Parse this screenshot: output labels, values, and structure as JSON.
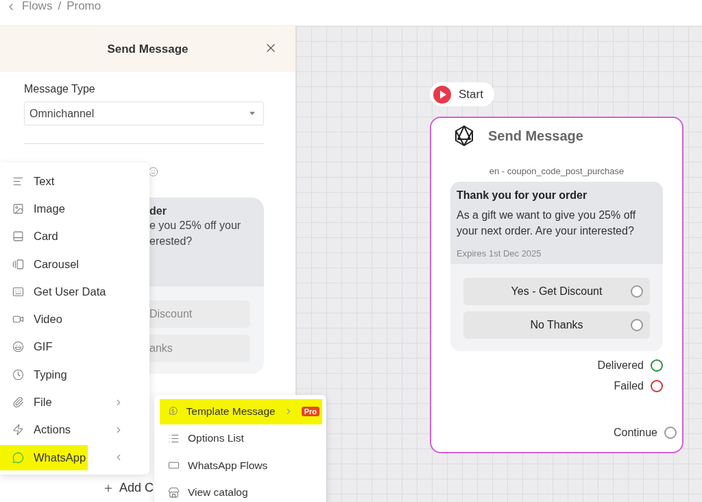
{
  "breadcrumb": {
    "items": [
      "Flows",
      "Promo"
    ],
    "separator": "/"
  },
  "panel": {
    "title": "Send Message",
    "field": {
      "label": "Message Type",
      "value": "Omnichannel"
    },
    "preview": {
      "title": "der",
      "body_lines": [
        "e you 25% off your",
        "erested?"
      ],
      "buttons": [
        "Discount",
        "anks"
      ]
    },
    "add_button": "Add C"
  },
  "menu": {
    "items": [
      {
        "label": "Text",
        "has_submenu": false,
        "highlighted": false
      },
      {
        "label": "Image",
        "has_submenu": false,
        "highlighted": false
      },
      {
        "label": "Card",
        "has_submenu": false,
        "highlighted": false
      },
      {
        "label": "Carousel",
        "has_submenu": false,
        "highlighted": false
      },
      {
        "label": "Get User Data",
        "has_submenu": false,
        "highlighted": false
      },
      {
        "label": "Video",
        "has_submenu": false,
        "highlighted": false
      },
      {
        "label": "GIF",
        "has_submenu": false,
        "highlighted": false
      },
      {
        "label": "Typing",
        "has_submenu": false,
        "highlighted": false
      },
      {
        "label": "File",
        "has_submenu": true,
        "expanded": false,
        "highlighted": false
      },
      {
        "label": "Actions",
        "has_submenu": true,
        "expanded": false,
        "highlighted": false
      },
      {
        "label": "WhatsApp",
        "has_submenu": true,
        "expanded": true,
        "highlighted": true
      }
    ]
  },
  "submenu": {
    "items": [
      {
        "label": "Template Message",
        "has_submenu": true,
        "expanded": false,
        "badge": "Pro",
        "highlighted": true
      },
      {
        "label": "Options List",
        "has_submenu": false,
        "highlighted": false
      },
      {
        "label": "WhatsApp Flows",
        "has_submenu": false,
        "highlighted": false
      },
      {
        "label": "View catalog",
        "has_submenu": false,
        "highlighted": false
      }
    ]
  },
  "canvas": {
    "start": "Start",
    "node": {
      "title": "Send Message",
      "template": "en - coupon_code_post_purchase",
      "message": {
        "title": "Thank you for your order",
        "body": "As a gift we want to give you 25% off your next order. Are your interested?",
        "footer": "Expires 1st Dec 2025"
      },
      "buttons": [
        {
          "label": "Yes - Get Discount"
        },
        {
          "label": "No Thanks"
        }
      ],
      "outputs": [
        {
          "label": "Delivered",
          "color": "#2f8f3c"
        },
        {
          "label": "Failed",
          "color": "#d9303b"
        }
      ],
      "continue": "Continue"
    }
  }
}
